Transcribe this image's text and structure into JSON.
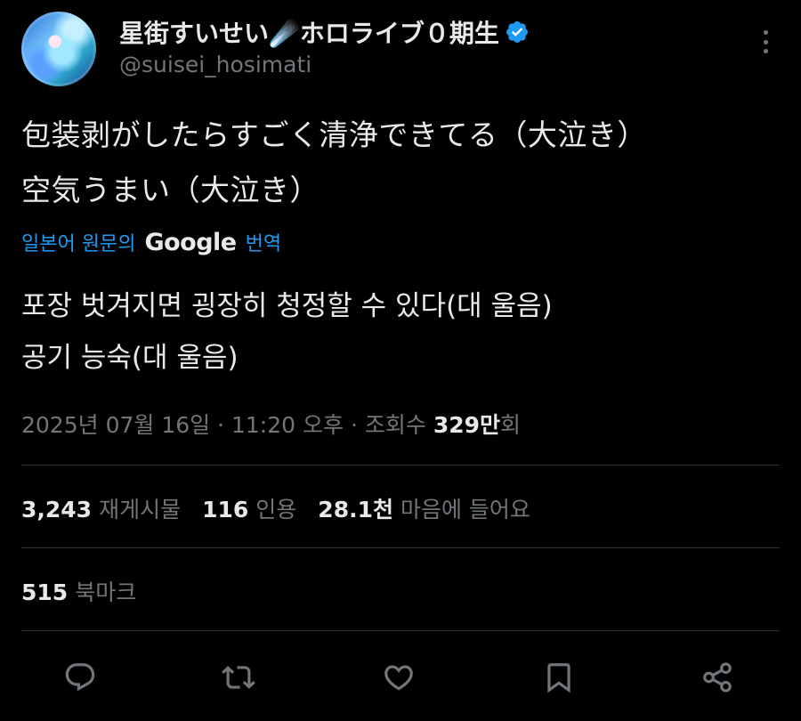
{
  "author": {
    "display_name": "星街すいせい☄️ホロライブ０期生",
    "handle": "@suisei_hosimati"
  },
  "tweet": {
    "text_lines": [
      "包装剥がしたらすごく清浄できてる（大泣き）",
      "空気うまい（大泣き）"
    ],
    "translation_label_prefix": "일본어 원문의",
    "translation_provider": "Google",
    "translation_label_suffix": "번역",
    "translated_lines": [
      "포장 벗겨지면 굉장히 청정할 수 있다(대 울음)",
      "공기 능숙(대 울음)"
    ]
  },
  "meta": {
    "date": "2025년 07월 16일",
    "separator": "·",
    "time": "11:20 오후",
    "views_label": "조회수",
    "views_count": "329만",
    "views_suffix": "회"
  },
  "stats": {
    "reposts_count": "3,243",
    "reposts_label": "재게시물",
    "quotes_count": "116",
    "quotes_label": "인용",
    "likes_count": "28.1천",
    "likes_label": "마음에 들어요",
    "bookmarks_count": "515",
    "bookmarks_label": "북마크"
  },
  "icons": [
    "verified-badge-icon",
    "more-icon",
    "reply-icon",
    "repost-icon",
    "like-icon",
    "bookmark-icon",
    "share-icon"
  ],
  "colors": {
    "background": "#000000",
    "text": "#e7e9ea",
    "secondary": "#71767b",
    "accent": "#1d9bf0",
    "divider": "#2f3336"
  }
}
